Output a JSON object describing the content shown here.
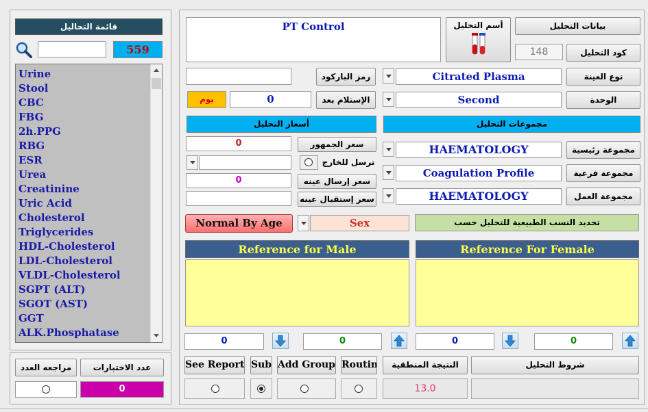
{
  "left_panel": {
    "title": "قائمة التحاليل",
    "count": "559",
    "search_value": "",
    "items": [
      "Urine",
      "Stool",
      "CBC",
      "FBG",
      "2h.PPG",
      "RBG",
      "ESR",
      "Urea",
      "Creatinine",
      "Uric Acid",
      "Cholesterol",
      "Triglycerides",
      "HDL-Cholesterol",
      "LDL-Cholesterol",
      "VLDL-Cholesterol",
      "SGPT (ALT)",
      "SGOT (AST)",
      "GGT",
      "ALK.Phosphatase"
    ],
    "review_count_label": "مراجعه العدد",
    "tests_count_label": "عدد الاختبارات",
    "tests_count_value": "0"
  },
  "test_info": {
    "section_button": "بيانات التحليل",
    "name_label": "أسم التحليل",
    "name_value": "PT Control",
    "code_label": "كود التحليل",
    "code_value": "148",
    "barcode_label": "رمز الباركود",
    "barcode_value": "",
    "sample_type_label": "نوع العينة",
    "sample_type_value": "Citrated Plasma",
    "receive_after_label": "الإستلام بعد",
    "receive_after_value": "0",
    "day_label": "يوم",
    "unit_label": "الوحدة",
    "unit_value": "Second"
  },
  "prices": {
    "header": "أسعار التحليل",
    "public_price_label": "سعر الجمهور",
    "public_price_value": "0",
    "send_out_label": "ترسل للخارج",
    "send_out_value": "",
    "send_sample_price_label": "سعر إرسال عينه",
    "send_sample_price_value": "0",
    "receive_sample_price_label": "سعر إستقبال عينه",
    "receive_sample_price_value": ""
  },
  "groups": {
    "header": "مجموعات التحليل",
    "main_label": "مجموعة رئيسية",
    "main_value": "HAEMATOLOGY",
    "sub_label": "مجموعة فرعية",
    "sub_value": "Coagulation Profile",
    "work_label": "مجموعة العمل",
    "work_value": "HAEMATOLOGY"
  },
  "normal_ranges": {
    "mode_button": "Normal By Age",
    "basis_value": "Sex",
    "basis_label": "تحديد النسب الطبيعية للتحليل حسب",
    "male_header": "Reference for Male",
    "female_header": "Reference For Female",
    "male_value": "",
    "female_value": "",
    "male_count_1": "0",
    "male_count_2": "0",
    "female_count_1": "0",
    "female_count_2": "0"
  },
  "bottom": {
    "see_report": "See Report",
    "sub": "Sub",
    "add_group": "Add Group",
    "routin": "Routin",
    "logical_result_label": "النتيجة المنطقية",
    "logical_result_value": "13.0",
    "conditions_label": "شروط التحليل",
    "conditions_value": ""
  },
  "colors": {
    "accent_blue": "#00b0f0",
    "header_navy": "#3a5f8f",
    "reference_yellow": "#ffff99",
    "count_magenta": "#cc00aa",
    "day_orange": "#ffc000",
    "list_gray": "#c0c0c0",
    "basis_green": "#c4e0a4"
  }
}
